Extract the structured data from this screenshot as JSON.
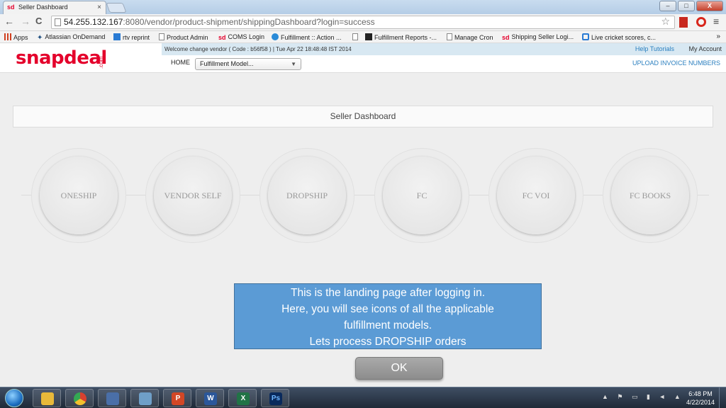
{
  "browser": {
    "tab_title": "Seller Dashboard",
    "tab_favicon": "sd",
    "tab_close": "×",
    "url_host": "54.255.132.167",
    "url_path": ":8080/vendor/product-shipment/shippingDashboard?login=success",
    "nav": {
      "back": "←",
      "forward": "→",
      "reload": "C"
    },
    "star": "☆",
    "menu": "≡",
    "window_buttons": {
      "minimize": "–",
      "maximize": "□",
      "close": "X"
    }
  },
  "bookmarks": [
    {
      "label": "Apps",
      "icon": "apps-grid-icon"
    },
    {
      "label": "Atlassian OnDemand",
      "icon": "atlassian-icon"
    },
    {
      "label": "rtv reprint",
      "icon": "tc-icon"
    },
    {
      "label": "Product Admin",
      "icon": "page-icon"
    },
    {
      "label": "COMS Login",
      "icon": "sd-icon"
    },
    {
      "label": "Fulfillment :: Action ...",
      "icon": "check-circle-icon"
    },
    {
      "label": "",
      "icon": "page-icon"
    },
    {
      "label": "Fulfillment Reports -...",
      "icon": "amazon-icon"
    },
    {
      "label": "Manage Cron",
      "icon": "page-icon"
    },
    {
      "label": "Shipping Seller Logi...",
      "icon": "sd-icon"
    },
    {
      "label": "Live cricket scores, c...",
      "icon": "c-icon"
    }
  ],
  "bookmarks_more": "»",
  "header": {
    "logo": "snapdeal",
    "logo_suffix": ".com",
    "welcome_text": "Welcome change vendor ( Code : b56f58 ) | Tue Apr 22 18:48:48 IST 2014",
    "help_link": "Help Tutorials",
    "account_link": "My Account",
    "home_link": "HOME",
    "model_select": "Fulfillment Model...",
    "upload_link": "UPLOAD INVOICE NUMBERS"
  },
  "dashboard": {
    "title": "Seller Dashboard",
    "models": [
      "ONESHIP",
      "VENDOR SELF",
      "DROPSHIP",
      "FC",
      "FC VOI",
      "FC BOOKS"
    ]
  },
  "overlay": {
    "lines": [
      "This is the landing page after logging in.",
      "Here, you will see icons of all the applicable",
      "fulfillment models.",
      "Lets process DROPSHIP orders"
    ],
    "ok_label": "OK"
  },
  "taskbar": {
    "apps": [
      {
        "name": "explorer",
        "glyph": "",
        "color": "#e8b93a"
      },
      {
        "name": "chrome",
        "glyph": "",
        "color": "#d9412f"
      },
      {
        "name": "dolphin",
        "glyph": "",
        "color": "#4a6fa8"
      },
      {
        "name": "notepad",
        "glyph": "",
        "color": "#6f9fc8"
      },
      {
        "name": "powerpoint",
        "glyph": "P",
        "color": "#d24726"
      },
      {
        "name": "word",
        "glyph": "W",
        "color": "#2b579a"
      },
      {
        "name": "excel",
        "glyph": "X",
        "color": "#217346"
      },
      {
        "name": "photoshop",
        "glyph": "Ps",
        "color": "#0a2a5c"
      }
    ],
    "clock_time": "6:48 PM",
    "clock_date": "4/22/2014"
  }
}
